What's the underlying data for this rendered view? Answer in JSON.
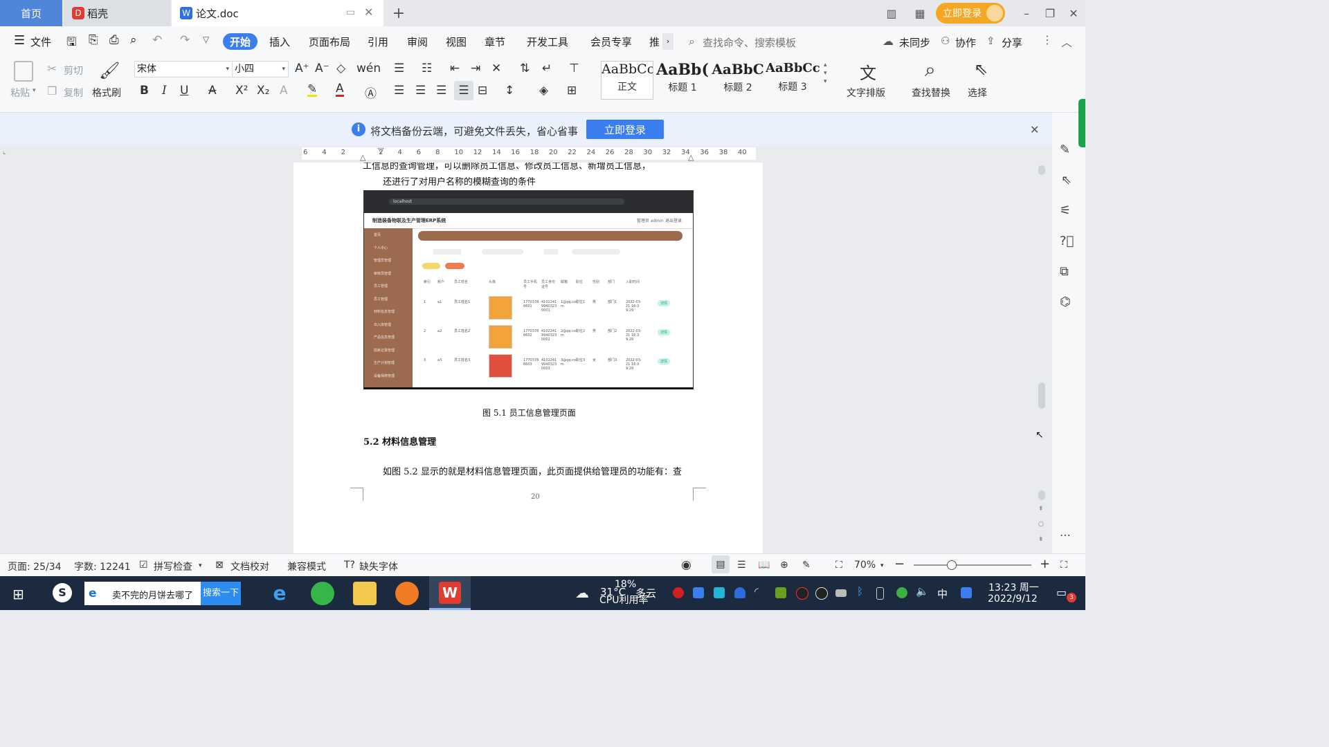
{
  "tabs": {
    "home": "首页",
    "daoke": "稻壳",
    "doc": "论文.doc"
  },
  "titlebar": {
    "login": "立即登录"
  },
  "menu": {
    "file": "文件",
    "items": [
      "开始",
      "插入",
      "页面布局",
      "引用",
      "审阅",
      "视图",
      "章节",
      "开发工具",
      "会员专享",
      "推"
    ],
    "search_placeholder": "查找命令、搜索模板",
    "sync": "未同步",
    "collab": "协作",
    "share": "分享"
  },
  "ribbon": {
    "paste": "粘贴",
    "cut": "剪切",
    "copy": "复制",
    "format_painter": "格式刷",
    "font_name": "宋体",
    "font_size": "小四",
    "styles": [
      {
        "sample": "AaBbCcI",
        "name": "正文"
      },
      {
        "sample": "AaBb(",
        "name": "标题 1"
      },
      {
        "sample": "AaBbC",
        "name": "标题 2"
      },
      {
        "sample": "AaBbCcl",
        "name": "标题 3"
      }
    ],
    "text_layout": "文字排版",
    "find_replace": "查找替换",
    "select": "选择"
  },
  "notice": {
    "text": "将文档备份云端，可避免文件丢失，省心省事",
    "button": "立即登录"
  },
  "ruler": [
    "6",
    "4",
    "2",
    "",
    "2",
    "4",
    "6",
    "8",
    "10",
    "12",
    "14",
    "16",
    "18",
    "20",
    "22",
    "24",
    "26",
    "28",
    "30",
    "32",
    "34",
    "36",
    "38",
    "40"
  ],
  "document": {
    "line_top_partial": "工信息的查询管理，可以删除员工信息、修改员工信息、新增员工信息，",
    "line_1": "还进行了对用户名称的模糊查询的条件",
    "figure_caption": "图 5.1 员工信息管理页面",
    "heading": "5.2  材料信息管理",
    "paragraph": "如图 5.2 显示的就是材料信息管理页面，此页面提供给管理员的功能有：查",
    "page_number": "20",
    "screenshot": {
      "app_title": "制造装备物联及生产管理ERP系统",
      "user": "管理员 admin",
      "logout": "退出登录",
      "url": "localhost",
      "sidebar": [
        "首页",
        "个人中心",
        "管理员管理",
        "审核员管理",
        "员工管理",
        "员工管理",
        "材料信息管理",
        "出入库管理",
        "产品信息管理",
        "损耗记录管理",
        "生产计划管理",
        "设备保修管理"
      ],
      "headers": [
        "索引",
        "账户",
        "员工姓名",
        "头像",
        "员工手机号",
        "员工身份证号",
        "邮箱",
        "职位",
        "性别",
        "部门",
        "入职时间"
      ],
      "rows": [
        {
          "idx": "1",
          "acct": "a1",
          "name": "员工姓名1",
          "phone": "17703786601",
          "idcard": "410224199403230001",
          "email": "1@qq.com",
          "pos": "职位1",
          "sex": "男",
          "dept": "部门1",
          "date": "2022-03-21 16:39:29"
        },
        {
          "idx": "2",
          "acct": "a2",
          "name": "员工姓名2",
          "phone": "17703786602",
          "idcard": "410224199403230002",
          "email": "2@qq.com",
          "pos": "职位2",
          "sex": "男",
          "dept": "部门2",
          "date": "2022-03-21 16:39:29"
        },
        {
          "idx": "3",
          "acct": "a3",
          "name": "员工姓名3",
          "phone": "17703786603",
          "idcard": "410224199403230003",
          "email": "3@qq.com",
          "pos": "职位3",
          "sex": "女",
          "dept": "部门3",
          "date": "2022-03-21 16:39:29"
        }
      ],
      "btn_detail": "详情"
    }
  },
  "status": {
    "page": "页面: 25/34",
    "words": "字数: 12241",
    "spell": "拼写检查",
    "proof": "文档校对",
    "compat": "兼容模式",
    "missing_font": "缺失字体",
    "zoom": "70%"
  },
  "taskbar": {
    "search_text": "卖不完的月饼去哪了",
    "search_btn": "搜索一下",
    "weather_temp": "31°C",
    "weather_desc": "多云",
    "cpu_pct": "18%",
    "cpu_label": "CPU利用率",
    "ime": "中",
    "time": "13:23 周一",
    "date": "2022/9/12",
    "notif_count": "3"
  },
  "colors": {
    "accent": "#3b7ef0",
    "login": "#f5a623",
    "sidebar_brown": "#9b6a4f"
  }
}
